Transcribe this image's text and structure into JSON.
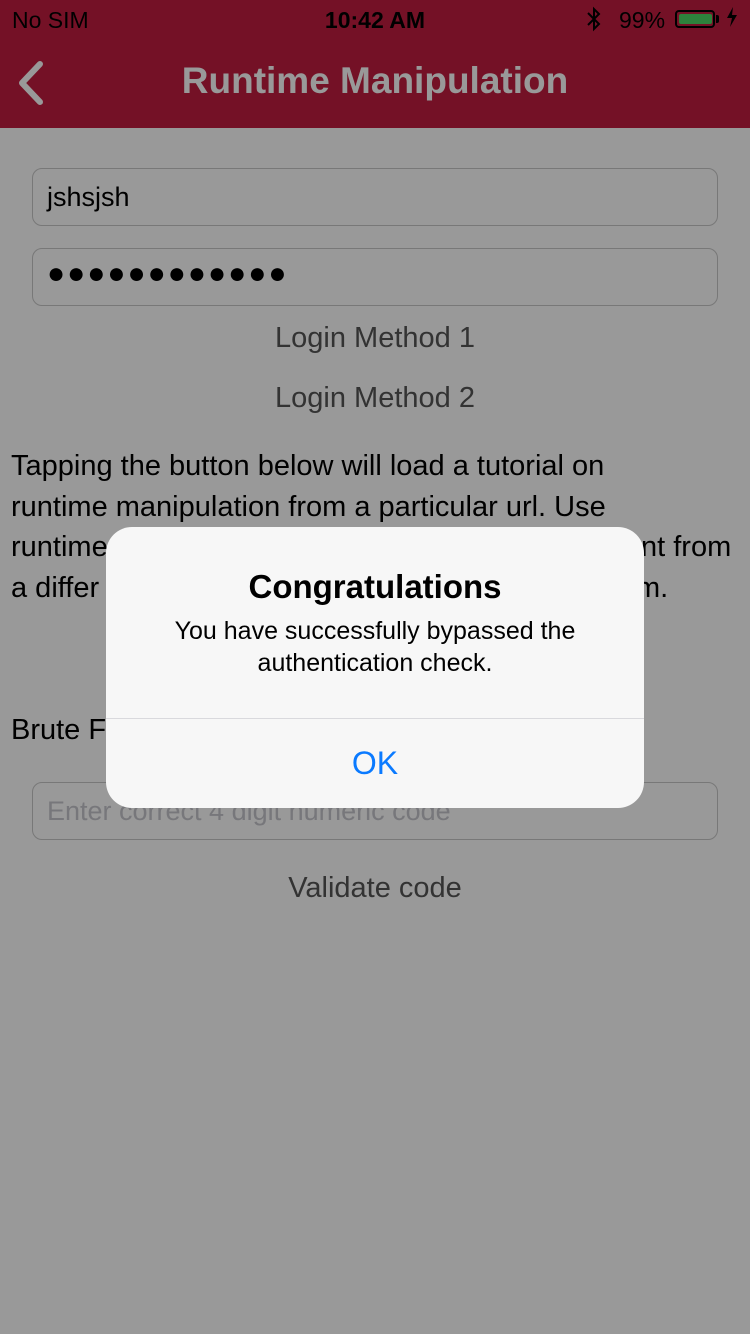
{
  "status_bar": {
    "carrier": "No SIM",
    "time": "10:42 AM",
    "bluetooth_icon": "bluetooth-icon",
    "battery_percent": "99%",
    "battery_level": 0.99,
    "battery_fill_color": "#4cd964"
  },
  "nav": {
    "title": "Runtime Manipulation",
    "back_icon": "chevron-left-icon",
    "bar_color": "#c21d40"
  },
  "form": {
    "username_value": "jshsjsh",
    "password_value": "●●●●●●●●●●●●",
    "login_method_1": "Login Method 1",
    "login_method_2": "Login Method 2"
  },
  "tutorial": {
    "line1": "Tapping the button below will load a tutorial on",
    "line2": "runtime manipulation from a particular url. Use",
    "line3_left": "runtime",
    "line3_right": "nt from",
    "line4_left": "a differ",
    "line4_right": "m."
  },
  "brute_force": {
    "label_visible": "Brute F",
    "code_placeholder": "Enter correct 4 digit numeric code",
    "validate_label": "Validate code"
  },
  "alert": {
    "title": "Congratulations",
    "message_line1": "You have successfully bypassed the",
    "message_line2": "authentication check.",
    "ok_label": "OK",
    "ok_color": "#0a7aff"
  }
}
